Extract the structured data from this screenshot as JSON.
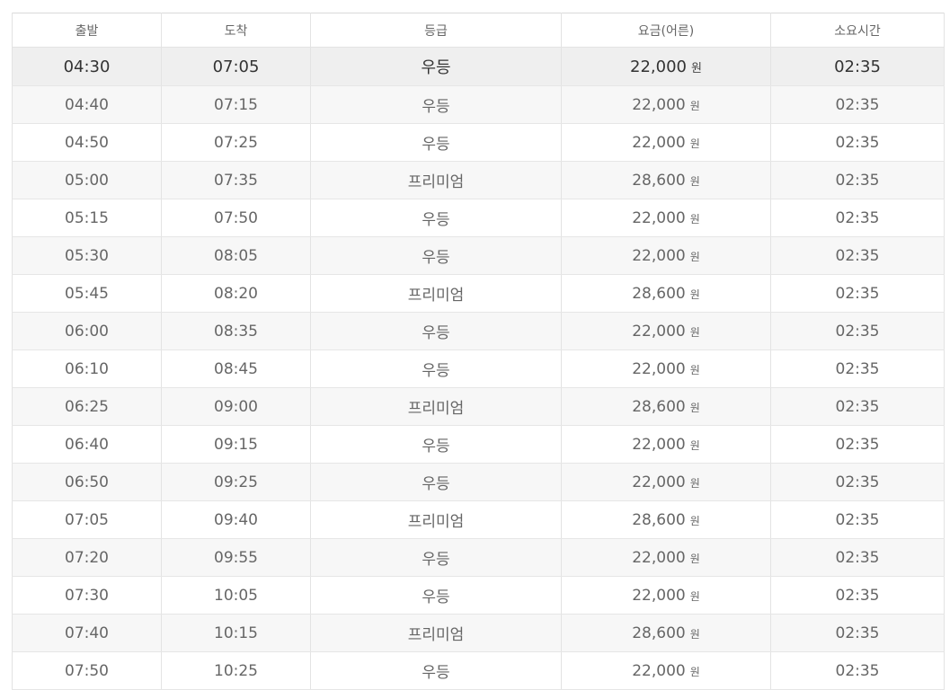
{
  "table": {
    "headers": {
      "departure": "출발",
      "arrival": "도착",
      "grade": "등급",
      "fare": "요금(어른)",
      "duration": "소요시간"
    },
    "fare_unit": "원",
    "selected_row_index": 0,
    "rows": [
      {
        "departure": "04:30",
        "arrival": "07:05",
        "grade": "우등",
        "fare": "22,000",
        "duration": "02:35"
      },
      {
        "departure": "04:40",
        "arrival": "07:15",
        "grade": "우등",
        "fare": "22,000",
        "duration": "02:35"
      },
      {
        "departure": "04:50",
        "arrival": "07:25",
        "grade": "우등",
        "fare": "22,000",
        "duration": "02:35"
      },
      {
        "departure": "05:00",
        "arrival": "07:35",
        "grade": "프리미엄",
        "fare": "28,600",
        "duration": "02:35"
      },
      {
        "departure": "05:15",
        "arrival": "07:50",
        "grade": "우등",
        "fare": "22,000",
        "duration": "02:35"
      },
      {
        "departure": "05:30",
        "arrival": "08:05",
        "grade": "우등",
        "fare": "22,000",
        "duration": "02:35"
      },
      {
        "departure": "05:45",
        "arrival": "08:20",
        "grade": "프리미엄",
        "fare": "28,600",
        "duration": "02:35"
      },
      {
        "departure": "06:00",
        "arrival": "08:35",
        "grade": "우등",
        "fare": "22,000",
        "duration": "02:35"
      },
      {
        "departure": "06:10",
        "arrival": "08:45",
        "grade": "우등",
        "fare": "22,000",
        "duration": "02:35"
      },
      {
        "departure": "06:25",
        "arrival": "09:00",
        "grade": "프리미엄",
        "fare": "28,600",
        "duration": "02:35"
      },
      {
        "departure": "06:40",
        "arrival": "09:15",
        "grade": "우등",
        "fare": "22,000",
        "duration": "02:35"
      },
      {
        "departure": "06:50",
        "arrival": "09:25",
        "grade": "우등",
        "fare": "22,000",
        "duration": "02:35"
      },
      {
        "departure": "07:05",
        "arrival": "09:40",
        "grade": "프리미엄",
        "fare": "28,600",
        "duration": "02:35"
      },
      {
        "departure": "07:20",
        "arrival": "09:55",
        "grade": "우등",
        "fare": "22,000",
        "duration": "02:35"
      },
      {
        "departure": "07:30",
        "arrival": "10:05",
        "grade": "우등",
        "fare": "22,000",
        "duration": "02:35"
      },
      {
        "departure": "07:40",
        "arrival": "10:15",
        "grade": "프리미엄",
        "fare": "28,600",
        "duration": "02:35"
      },
      {
        "departure": "07:50",
        "arrival": "10:25",
        "grade": "우등",
        "fare": "22,000",
        "duration": "02:35"
      }
    ]
  }
}
